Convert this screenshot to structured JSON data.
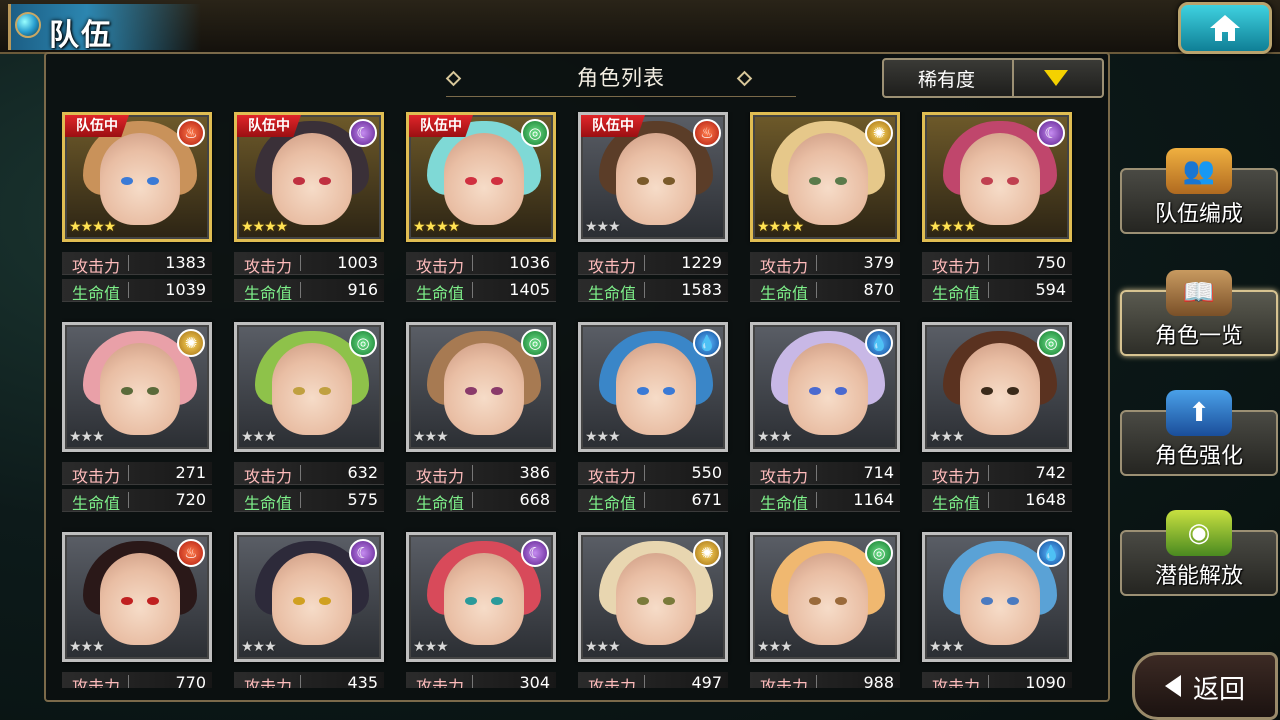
{
  "header": {
    "title": "队伍"
  },
  "list": {
    "title": "角色列表",
    "sort_label": "稀有度"
  },
  "labels": {
    "team_badge": "队伍中",
    "atk": "攻击力",
    "hp": "生命值"
  },
  "characters": [
    {
      "in_team": true,
      "element": "fire",
      "rarity": 4,
      "atk": "1383",
      "hp": "1039"
    },
    {
      "in_team": true,
      "element": "moon",
      "rarity": 4,
      "atk": "1003",
      "hp": "916"
    },
    {
      "in_team": true,
      "element": "wind",
      "rarity": 4,
      "atk": "1036",
      "hp": "1405"
    },
    {
      "in_team": true,
      "element": "fire",
      "rarity": 3,
      "atk": "1229",
      "hp": "1583"
    },
    {
      "in_team": false,
      "element": "sun",
      "rarity": 4,
      "atk": "379",
      "hp": "870"
    },
    {
      "in_team": false,
      "element": "moon",
      "rarity": 4,
      "atk": "750",
      "hp": "594"
    },
    {
      "in_team": false,
      "element": "sun",
      "rarity": 3,
      "atk": "271",
      "hp": "720"
    },
    {
      "in_team": false,
      "element": "wind",
      "rarity": 3,
      "atk": "632",
      "hp": "575"
    },
    {
      "in_team": false,
      "element": "wind",
      "rarity": 3,
      "atk": "386",
      "hp": "668"
    },
    {
      "in_team": false,
      "element": "water",
      "rarity": 3,
      "atk": "550",
      "hp": "671"
    },
    {
      "in_team": false,
      "element": "water",
      "rarity": 3,
      "atk": "714",
      "hp": "1164"
    },
    {
      "in_team": false,
      "element": "wind",
      "rarity": 3,
      "atk": "742",
      "hp": "1648"
    },
    {
      "in_team": false,
      "element": "fire",
      "rarity": 3,
      "atk": "770",
      "hp": ""
    },
    {
      "in_team": false,
      "element": "moon",
      "rarity": 3,
      "atk": "435",
      "hp": ""
    },
    {
      "in_team": false,
      "element": "moon",
      "rarity": 3,
      "atk": "304",
      "hp": ""
    },
    {
      "in_team": false,
      "element": "sun",
      "rarity": 3,
      "atk": "497",
      "hp": ""
    },
    {
      "in_team": false,
      "element": "wind",
      "rarity": 3,
      "atk": "988",
      "hp": ""
    },
    {
      "in_team": false,
      "element": "water",
      "rarity": 3,
      "atk": "1090",
      "hp": ""
    }
  ],
  "side_menu": [
    {
      "label": "队伍编成",
      "icon": "team-members-icon",
      "active": false
    },
    {
      "label": "角色一览",
      "icon": "book-icon",
      "active": true
    },
    {
      "label": "角色强化",
      "icon": "power-up-icon",
      "active": false
    },
    {
      "label": "潜能解放",
      "icon": "orb-icon",
      "active": false
    }
  ],
  "back": {
    "label": "返回"
  },
  "colors": {
    "accent": "#f4d100",
    "atk_label": "#ffbcbc",
    "hp_label": "#7ef08a",
    "badge": "#e0262a"
  }
}
